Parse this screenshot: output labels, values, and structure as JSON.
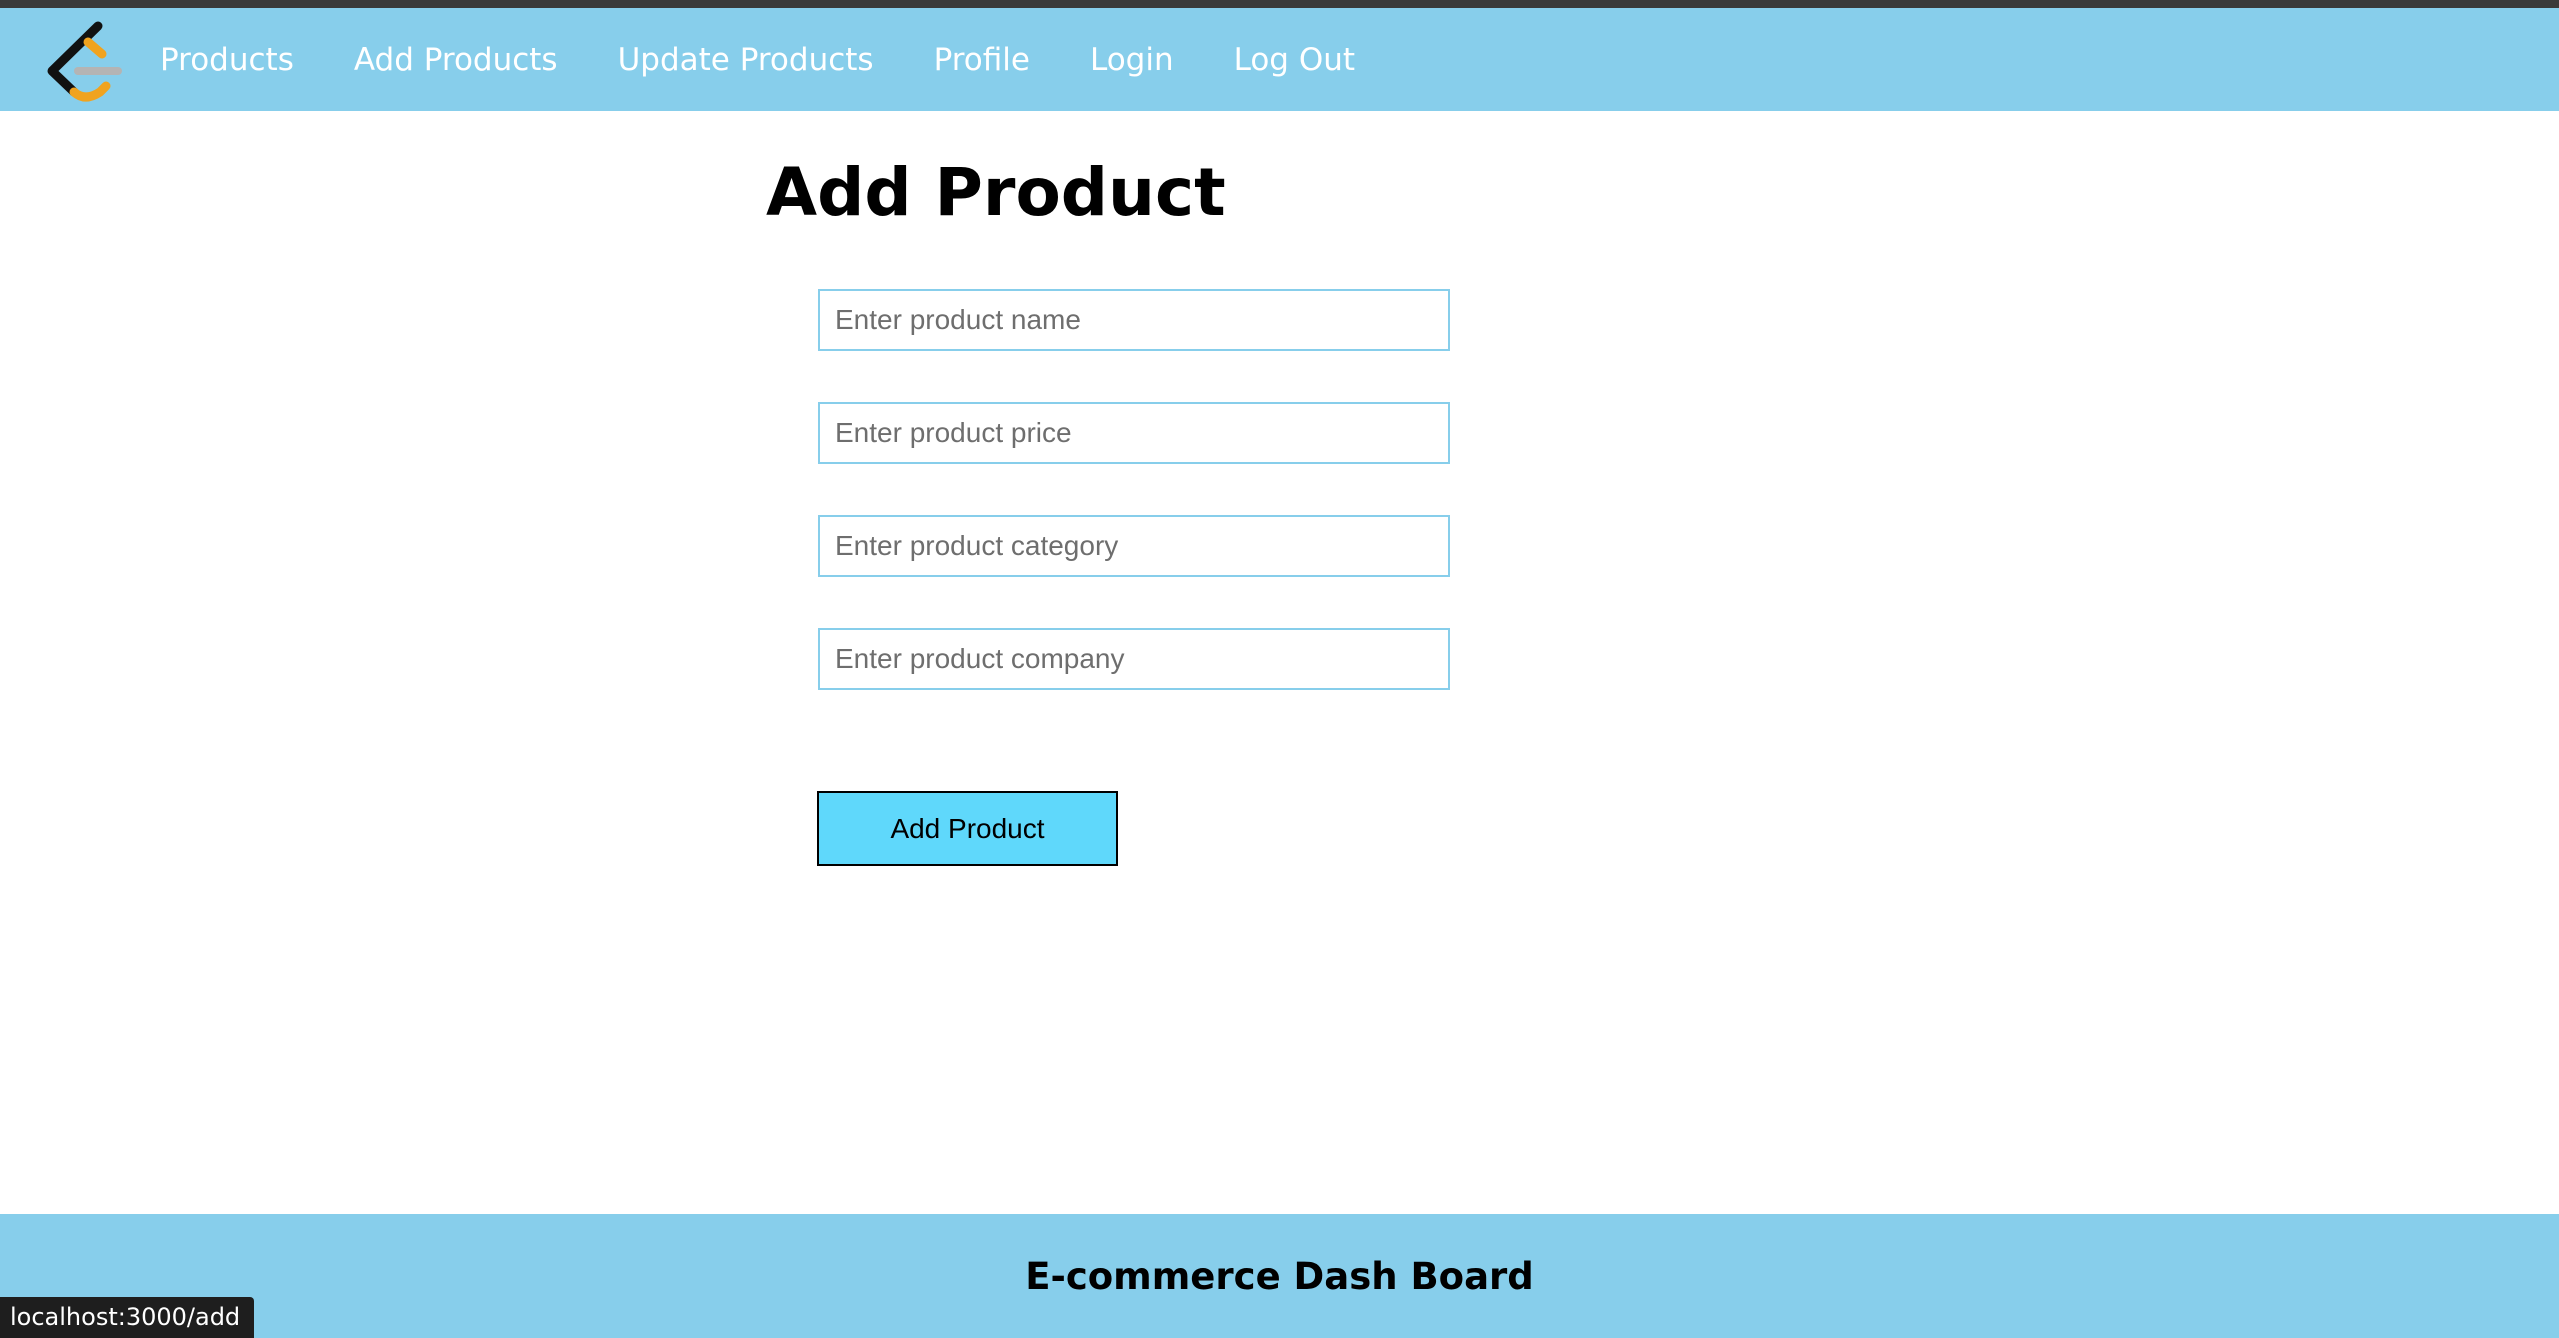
{
  "nav": {
    "logo_icon": "leetcode-style-logo-icon",
    "links": [
      {
        "label": "Products"
      },
      {
        "label": "Add Products"
      },
      {
        "label": "Update Products"
      },
      {
        "label": "Profile"
      },
      {
        "label": "Login"
      },
      {
        "label": "Log Out"
      }
    ]
  },
  "main": {
    "title": "Add Product",
    "fields": {
      "name": {
        "placeholder": "Enter product name",
        "value": ""
      },
      "price": {
        "placeholder": "Enter product price",
        "value": ""
      },
      "category": {
        "placeholder": "Enter product category",
        "value": ""
      },
      "company": {
        "placeholder": "Enter product company",
        "value": ""
      }
    },
    "submit_label": "Add Product"
  },
  "footer": {
    "title": "E-commerce Dash Board"
  },
  "status_bar": {
    "url": "localhost:3000/add"
  },
  "colors": {
    "navbar_bg": "#87ceeb",
    "button_bg": "#5fd8fb",
    "input_border": "#87ceeb",
    "logo_black": "#111111",
    "logo_orange": "#f0a31f",
    "logo_grey": "#b4b4b4"
  }
}
